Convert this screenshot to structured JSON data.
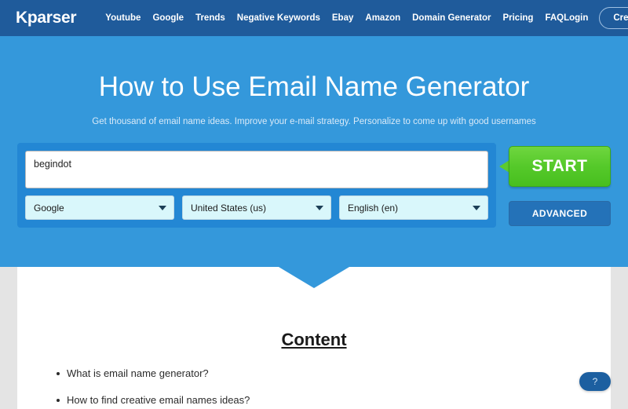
{
  "navbar": {
    "logo": "Kparser",
    "links": [
      {
        "label": "Youtube"
      },
      {
        "label": "Google"
      },
      {
        "label": "Trends"
      },
      {
        "label": "Negative Keywords"
      },
      {
        "label": "Ebay"
      },
      {
        "label": "Amazon"
      },
      {
        "label": "Domain Generator"
      },
      {
        "label": "Pricing"
      },
      {
        "label": "FAQ"
      }
    ],
    "login_label": "Login",
    "create_account_label": "Create account",
    "background_color": "#1f5b9b"
  },
  "hero": {
    "title": "How to Use Email Name Generator",
    "subtitle": "Get thousand of email name ideas. Improve your e-mail strategy. Personalize to come up with good usernames",
    "background_color": "#3498db"
  },
  "form": {
    "keyword_value": "begindot",
    "keyword_placeholder": "",
    "engine_select": "Google",
    "country_select": "United States (us)",
    "language_select": "English (en)",
    "start_label": "START",
    "advanced_label": "ADVANCED",
    "start_color": "#55c92a",
    "advanced_color": "#2472b8"
  },
  "content": {
    "heading": "Content",
    "items": [
      {
        "label": "What is email name generator?"
      },
      {
        "label": "How to find creative email names ideas?"
      }
    ]
  },
  "help": {
    "label": "?"
  }
}
